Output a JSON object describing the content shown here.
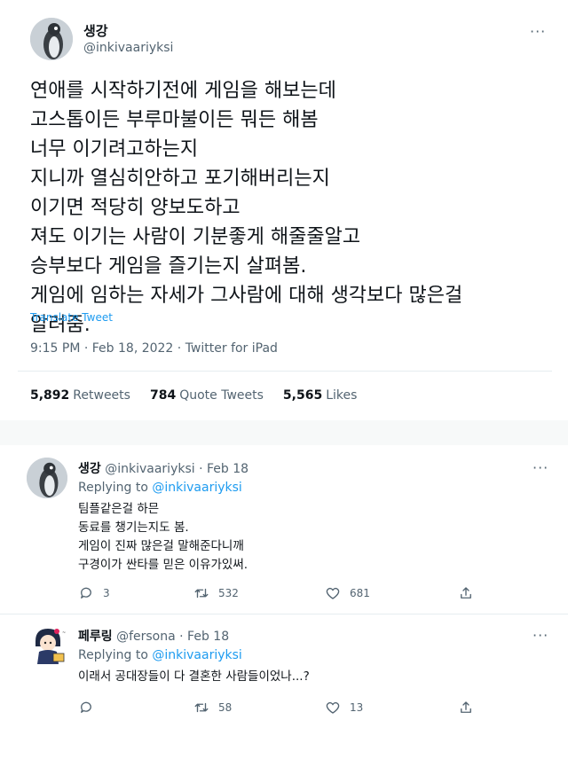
{
  "tweet": {
    "display_name": "생강",
    "handle": "@inkivaariyksi",
    "more_icon": "···",
    "lines": [
      "연애를 시작하기전에 게임을 해보는데",
      "고스톱이든 부루마불이든 뭐든 해봄",
      "너무 이기려고하는지",
      "지니까 열심히안하고 포기해버리는지",
      "이기면 적당히 양보도하고",
      "져도 이기는 사람이 기분좋게 해줄줄알고",
      "승부보다 게임을 즐기는지 살펴봄.",
      "게임에 임하는 자세가 그사람에 대해 생각보다 많은걸",
      "알려줌."
    ],
    "translate": "Translate Tweet",
    "meta": "9:15 PM · Feb 18, 2022 · Twitter for iPad",
    "stats": [
      {
        "count": "5,892",
        "label": "Retweets"
      },
      {
        "count": "784",
        "label": "Quote Tweets"
      },
      {
        "count": "5,565",
        "label": "Likes"
      }
    ]
  },
  "replies": [
    {
      "name": "생강",
      "handle_date": "@inkivaariyksi · Feb 18",
      "replying_prefix": "Replying to",
      "replying_to": "@inkivaariyksi",
      "lines": [
        "팀플같은걸 하믄",
        "동료를 챙기는지도 봄.",
        "게임이 진짜 많은걸 말해준다니깨",
        "구경이가 싼타를 믿은 이유가있써."
      ],
      "reply_count": "3",
      "retweet_count": "532",
      "like_count": "681"
    },
    {
      "name": "페루링",
      "handle_date": "@fersona · Feb 18",
      "replying_prefix": "Replying to",
      "replying_to": "@inkivaariyksi",
      "lines": [
        "이래서 공대장들이 다 결혼한 사람들이었나...?"
      ],
      "reply_count": "",
      "retweet_count": "58",
      "like_count": "13"
    }
  ],
  "colors": {
    "text": "#0f1419",
    "secondary": "#536471",
    "link": "#1d9bf0",
    "divider": "#e6ecf0"
  },
  "icons": [
    "more-icon",
    "reply-icon",
    "retweet-icon",
    "like-icon",
    "share-icon"
  ]
}
